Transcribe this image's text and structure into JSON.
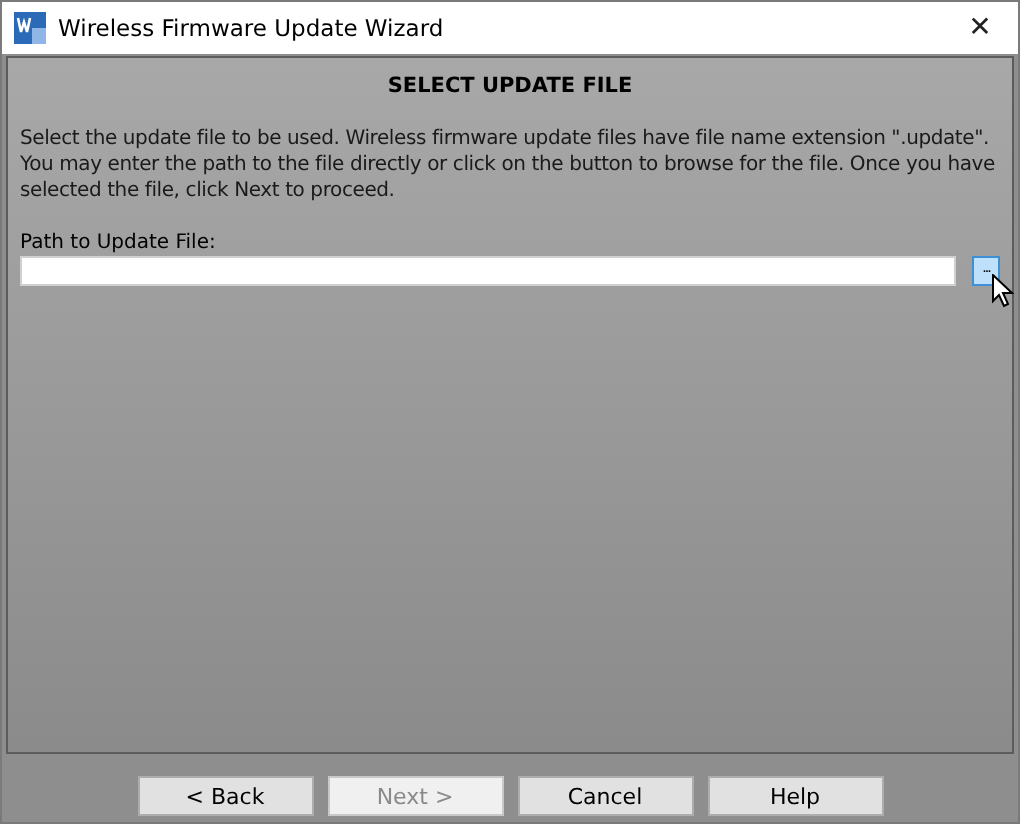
{
  "window": {
    "title": "Wireless Firmware Update Wizard",
    "close": "✕"
  },
  "page": {
    "heading": "SELECT UPDATE FILE",
    "description": "Select the update file to be used. Wireless firmware update files have file name extension \".update\". You may enter the path to the file directly or click on the button to browse for the file. Once you have selected the file, click Next to proceed.",
    "path_label": "Path to Update File:",
    "browse_button": "..."
  },
  "buttons": [
    {
      "label": "< Back",
      "disabled": false
    },
    {
      "label": "Next >",
      "disabled": true
    },
    {
      "label": "Cancel",
      "disabled": false
    },
    {
      "label": "Help",
      "disabled": false
    }
  ]
}
